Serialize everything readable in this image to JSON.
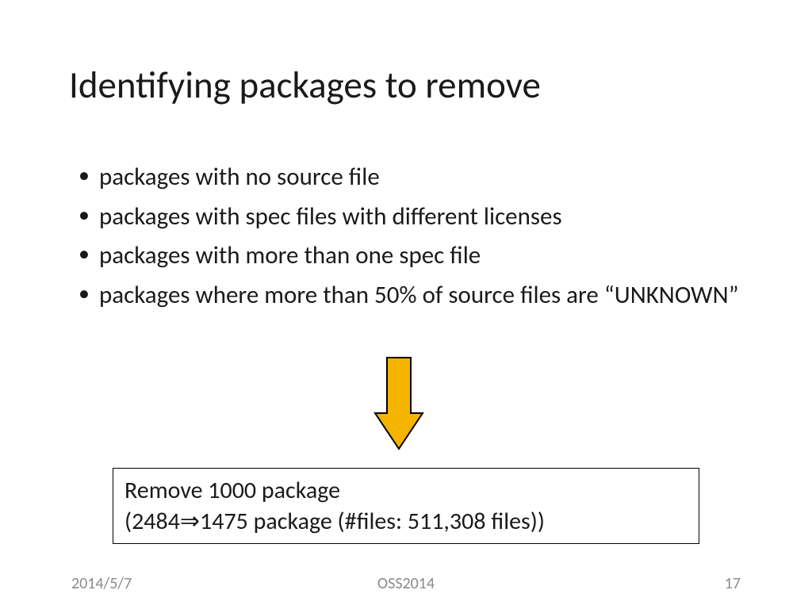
{
  "title": "Identifying packages to remove",
  "bullets": [
    "packages with no source file",
    "packages with spec files with different licenses",
    "packages with more than one spec file",
    "packages where more than 50% of source files are “UNKNOWN”"
  ],
  "result": {
    "line1": "Remove 1000 package",
    "line2": "(2484⇒1475 package (#files: 511,308 files))"
  },
  "footer": {
    "date": "2014/5/7",
    "event": "OSS2014",
    "page": "17"
  },
  "arrow_color": "#f4b400"
}
